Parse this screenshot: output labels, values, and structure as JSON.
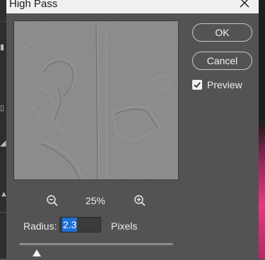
{
  "dialog": {
    "title": "High Pass",
    "ok_label": "OK",
    "cancel_label": "Cancel",
    "preview_label": "Preview",
    "preview_checked": true,
    "zoom_level": "25%",
    "radius_label": "Radius:",
    "radius_value": "2.3",
    "radius_unit": "Pixels",
    "icons": {
      "close": "close-icon",
      "zoom_out": "zoom-out-icon",
      "zoom_in": "zoom-in-icon",
      "check": "checkmark-icon",
      "slider": "slider-thumb"
    },
    "colors": {
      "dialog_bg": "#535353",
      "titlebar_bg": "#f0f0f0",
      "preview_gray": "#7f7f7f",
      "selection": "#1e6fd9"
    }
  }
}
